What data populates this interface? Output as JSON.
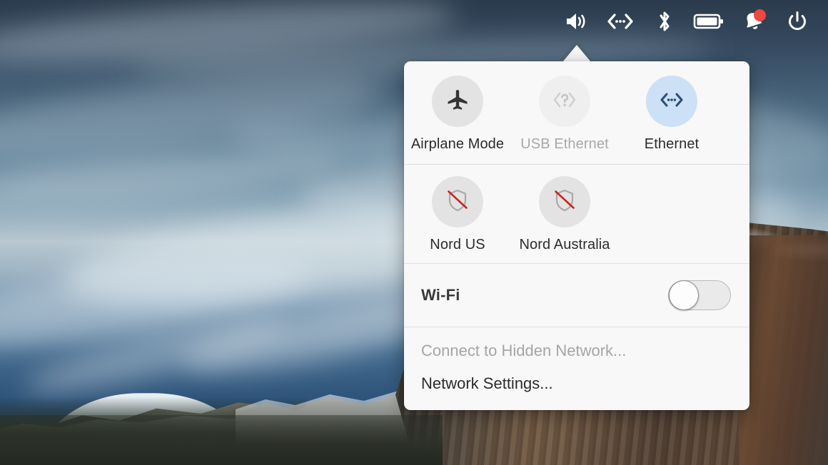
{
  "topbar": {
    "items": [
      {
        "name": "volume-icon",
        "label": "Volume"
      },
      {
        "name": "network-icon",
        "label": "Network"
      },
      {
        "name": "bluetooth-icon",
        "label": "Bluetooth"
      },
      {
        "name": "battery-icon",
        "label": "Battery"
      },
      {
        "name": "notifications-icon",
        "label": "Notifications",
        "badge": true
      },
      {
        "name": "power-icon",
        "label": "Power"
      }
    ]
  },
  "panel": {
    "quick_toggles_row1": [
      {
        "label": "Airplane Mode",
        "icon": "airplane-icon",
        "state": "off",
        "enabled": true
      },
      {
        "label": "USB Ethernet",
        "icon": "unknown-network-icon",
        "state": "unavailable",
        "enabled": false
      },
      {
        "label": "Ethernet",
        "icon": "ethernet-icon",
        "state": "on",
        "enabled": true
      }
    ],
    "quick_toggles_row2": [
      {
        "label": "Nord US",
        "icon": "vpn-disconnected-icon",
        "state": "off",
        "enabled": true
      },
      {
        "label": "Nord Australia",
        "icon": "vpn-disconnected-icon",
        "state": "off",
        "enabled": true
      }
    ],
    "wifi": {
      "label": "Wi-Fi",
      "toggle_state": "off"
    },
    "menu_items": [
      {
        "label": "Connect to Hidden Network...",
        "enabled": false
      },
      {
        "label": "Network Settings...",
        "enabled": true
      }
    ]
  },
  "colors": {
    "panel_background": "#f8f8f8",
    "tile_idle": "#e3e3e3",
    "tile_active": "#cce0f6",
    "tile_active_icon": "#2b4f73",
    "tile_dim": "#efefef",
    "text_primary": "#2c2c2c",
    "text_disabled": "#a5a5a5",
    "vpn_slash": "#cc2222",
    "badge": "#f0473f",
    "divider": "#e0e0e0"
  }
}
